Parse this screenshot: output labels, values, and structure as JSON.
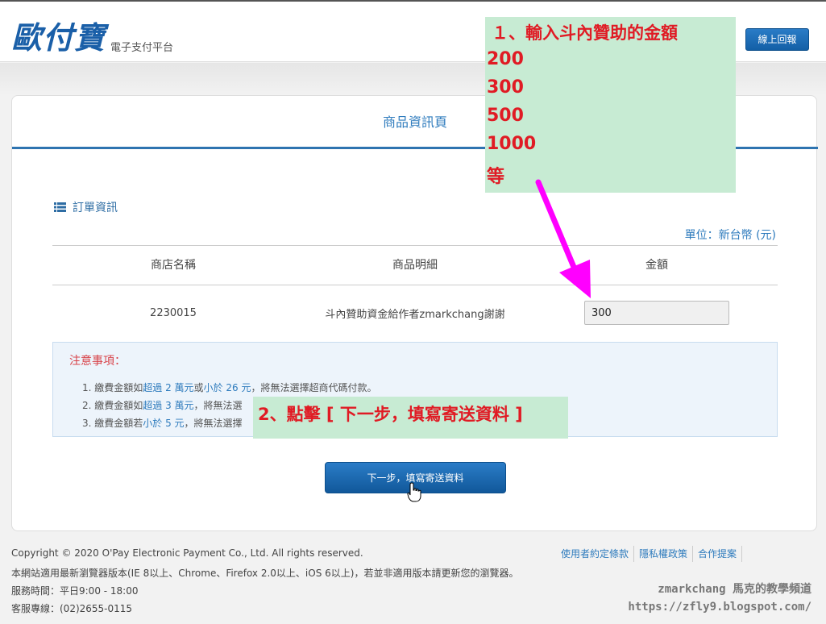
{
  "header": {
    "logo_text": "歐付寶",
    "logo_sub": "電子支付平台",
    "online_button": "線上回報"
  },
  "card": {
    "title": "商品資訊頁",
    "order_info": "訂單資訊",
    "unit": "單位：新台幣 (元)"
  },
  "table": {
    "headers": [
      "商店名稱",
      "商品明細",
      "金額"
    ],
    "row": {
      "store": "2230015",
      "detail": "斗內贊助資金給作者zmarkchang謝謝",
      "amount": "300"
    }
  },
  "notice": {
    "title": "注意事項：",
    "items": [
      {
        "prefix": "1. 繳費金額如",
        "hl": "超過 2 萬元",
        "mid": "或",
        "hl2": "小於 26 元",
        "suffix": "，將無法選擇超商代碼付款。"
      },
      {
        "prefix": "2. 繳費金額如",
        "hl": "超過 3 萬元",
        "mid": "",
        "hl2": "",
        "suffix": "，將無法選"
      },
      {
        "prefix": "3. 繳費金額若",
        "hl": "小於 5 元",
        "mid": "",
        "hl2": "",
        "suffix": "，將無法選擇"
      }
    ]
  },
  "next_button": "下一步，填寫寄送資料",
  "footer": {
    "copyright": "Copyright © 2020 O'Pay Electronic Payment Co., Ltd. All rights reserved.",
    "browser_note": "本網站適用最新瀏覽器版本(IE 8以上、Chrome、Firefox 2.0以上、iOS 6以上)，若並非適用版本請更新您的瀏覽器。",
    "hours": "服務時間：平日9:00 - 18:00",
    "hotline": "客服專線：(02)2655-0115",
    "links": [
      "使用者約定條款",
      "隱私權政策",
      "合作提案"
    ]
  },
  "annotations": {
    "step1_title": "１、輸入斗內贊助的金額",
    "step1_values": [
      "200",
      "300",
      "500",
      "1000",
      "等"
    ],
    "step2": "2、點擊 [ 下一步，填寫寄送資料 ]"
  },
  "watermark": {
    "line1": "zmarkchang 馬克的教學頻道",
    "line2": "https://zfly9.blogspot.com/"
  },
  "colors": {
    "brand_blue": "#2e7bbd",
    "button_blue": "#135fa6",
    "annotation_bg": "#c7ebd3",
    "annotation_text": "#e01b24",
    "arrow": "#ff00ff",
    "notice_title": "#d8434a"
  }
}
